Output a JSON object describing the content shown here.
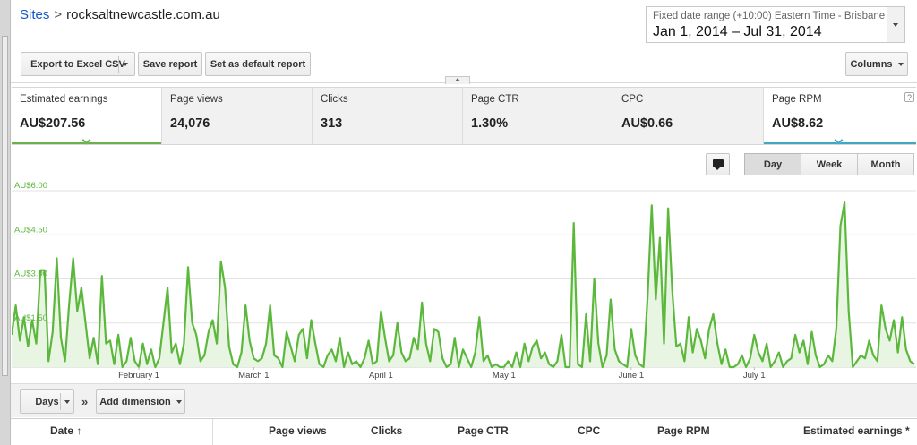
{
  "breadcrumb": {
    "root": "Sites",
    "separator": ">",
    "current": "rocksaltnewcastle.com.au"
  },
  "date_range": {
    "caption": "Fixed date range (+10:00) Eastern Time - Brisbane",
    "value": "Jan 1, 2014 – Jul 31, 2014"
  },
  "toolbar": {
    "export_label": "Export to Excel CSV",
    "save_label": "Save report",
    "default_label": "Set as default report",
    "columns_label": "Columns"
  },
  "metrics": [
    {
      "label": "Estimated earnings",
      "value": "AU$207.56",
      "color": "#6ab04c"
    },
    {
      "label": "Page views",
      "value": "24,076"
    },
    {
      "label": "Clicks",
      "value": "313"
    },
    {
      "label": "Page CTR",
      "value": "1.30%"
    },
    {
      "label": "CPC",
      "value": "AU$0.66"
    },
    {
      "label": "Page RPM",
      "value": "AU$8.62",
      "color": "#3fa9c4"
    }
  ],
  "help_glyph": "?",
  "granularity": {
    "day": "Day",
    "week": "Week",
    "month": "Month",
    "selected": "Day"
  },
  "chart_data": {
    "type": "area",
    "series_color": "#5cb83c",
    "fill_color": "#e8f5e3",
    "ylim": [
      0,
      6
    ],
    "y_ticks": [
      {
        "value": 1.5,
        "label": "AU$1.50"
      },
      {
        "value": 3,
        "label": "AU$3.00"
      },
      {
        "value": 4.5,
        "label": "AU$4.50"
      },
      {
        "value": 6,
        "label": "AU$6.00"
      }
    ],
    "x_ticks": [
      {
        "day": 31,
        "label": "February 1"
      },
      {
        "day": 59,
        "label": "March 1"
      },
      {
        "day": 90,
        "label": "April 1"
      },
      {
        "day": 120,
        "label": "May 1"
      },
      {
        "day": 151,
        "label": "June 1"
      },
      {
        "day": 181,
        "label": "July 1"
      }
    ],
    "values": [
      1.1,
      2.1,
      0.9,
      1.7,
      0.7,
      1.6,
      0.8,
      3.3,
      3.3,
      0.2,
      1.2,
      3.7,
      1.0,
      0.2,
      2.1,
      3.7,
      1.9,
      2.7,
      1.5,
      0.3,
      1.0,
      0.1,
      3.1,
      0.8,
      0.9,
      0.1,
      1.1,
      0.0,
      0.2,
      1.0,
      0.2,
      0.0,
      0.8,
      0.1,
      0.6,
      0.0,
      0.3,
      1.5,
      2.7,
      0.5,
      0.8,
      0.1,
      0.8,
      3.4,
      1.5,
      1.1,
      0.2,
      0.4,
      1.2,
      1.6,
      0.8,
      3.6,
      2.7,
      0.7,
      0.1,
      0.0,
      0.5,
      2.1,
      0.9,
      0.3,
      0.2,
      0.3,
      0.8,
      2.1,
      0.4,
      0.3,
      0.0,
      1.2,
      0.7,
      0.2,
      1.1,
      1.3,
      0.3,
      1.6,
      0.8,
      0.1,
      0.0,
      0.4,
      0.6,
      0.2,
      1.0,
      0.0,
      0.5,
      0.1,
      0.2,
      0.0,
      0.3,
      0.9,
      0.1,
      0.2,
      1.9,
      1.0,
      0.2,
      0.4,
      1.5,
      0.5,
      0.2,
      0.3,
      1.0,
      0.6,
      2.2,
      0.8,
      0.2,
      1.3,
      1.2,
      0.3,
      0.0,
      0.1,
      1.0,
      0.0,
      0.6,
      0.3,
      0.0,
      0.5,
      1.7,
      0.2,
      0.4,
      0.0,
      0.1,
      0.0,
      0.0,
      0.2,
      0.0,
      0.5,
      0.0,
      0.8,
      0.2,
      0.7,
      0.9,
      0.3,
      0.5,
      0.1,
      0.0,
      0.2,
      1.1,
      0.0,
      0.0,
      4.9,
      0.1,
      0.0,
      1.8,
      0.2,
      3.0,
      0.8,
      0.0,
      0.4,
      2.3,
      0.6,
      0.2,
      0.1,
      0.0,
      1.3,
      0.4,
      0.1,
      0.0,
      2.4,
      5.5,
      2.3,
      4.4,
      0.8,
      5.4,
      2.6,
      0.7,
      0.8,
      0.2,
      1.7,
      0.5,
      1.3,
      0.9,
      0.3,
      1.3,
      1.8,
      0.8,
      0.1,
      0.6,
      0.0,
      0.0,
      0.1,
      0.4,
      0.0,
      0.3,
      1.1,
      0.5,
      0.2,
      0.8,
      0.0,
      0.2,
      0.5,
      0.0,
      0.2,
      0.3,
      1.1,
      0.5,
      0.9,
      0.1,
      1.2,
      0.4,
      0.0,
      0.1,
      0.4,
      0.2,
      1.3,
      4.8,
      5.6,
      1.9,
      0.0,
      0.2,
      0.4,
      0.3,
      0.9,
      0.4,
      0.2,
      2.1,
      1.3,
      0.9,
      1.6,
      0.5,
      1.7,
      0.6,
      0.2,
      0.1
    ]
  },
  "bottom_bar": {
    "days_label": "Days",
    "chevron": "»",
    "add_dimension_label": "Add dimension"
  },
  "table": {
    "headers": {
      "date": "Date",
      "sort_arrow": "↑",
      "page_views": "Page views",
      "clicks": "Clicks",
      "page_ctr": "Page CTR",
      "cpc": "CPC",
      "page_rpm": "Page RPM",
      "estimated_earnings": "Estimated earnings",
      "earnings_marker": "*"
    }
  }
}
